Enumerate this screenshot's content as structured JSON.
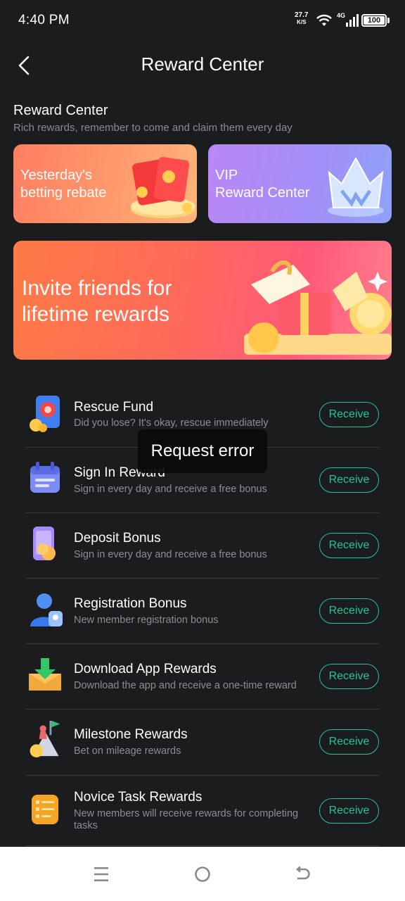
{
  "status_bar": {
    "time": "4:40 PM",
    "speed_value": "27.7",
    "speed_unit": "K/S",
    "network": "4G",
    "battery": "100"
  },
  "header": {
    "title": "Reward Center"
  },
  "section": {
    "title": "Reward Center",
    "subtitle": "Rich rewards, remember to come and claim them every day"
  },
  "cards": {
    "rebate": "Yesterday's\nbetting rebate",
    "vip": "VIP\nReward Center",
    "invite": "Invite friends for\nlifetime rewards"
  },
  "rewards": [
    {
      "title": "Rescue Fund",
      "desc": "Did you lose? It's okay, rescue immediately",
      "button": "Receive",
      "icon": "rescue-fund-icon"
    },
    {
      "title": "Sign In Reward",
      "desc": "Sign in every day and receive a free bonus",
      "button": "Receive",
      "icon": "calendar-icon"
    },
    {
      "title": "Deposit Bonus",
      "desc": "Sign in every day and receive a free bonus",
      "button": "Receive",
      "icon": "deposit-phone-icon"
    },
    {
      "title": "Registration Bonus",
      "desc": "New member registration bonus",
      "button": "Receive",
      "icon": "user-icon"
    },
    {
      "title": "Download App Rewards",
      "desc": "Download the app and receive a one-time reward",
      "button": "Receive",
      "icon": "download-icon"
    },
    {
      "title": "Milestone Rewards",
      "desc": "Bet on mileage rewards",
      "button": "Receive",
      "icon": "milestone-flag-icon"
    },
    {
      "title": "Novice Task Rewards",
      "desc": "New members will receive rewards for completing tasks",
      "button": "Receive",
      "icon": "task-list-icon"
    }
  ],
  "toast": {
    "message": "Request error"
  },
  "colors": {
    "accent": "#23c49b",
    "background": "#1b1c1e"
  }
}
